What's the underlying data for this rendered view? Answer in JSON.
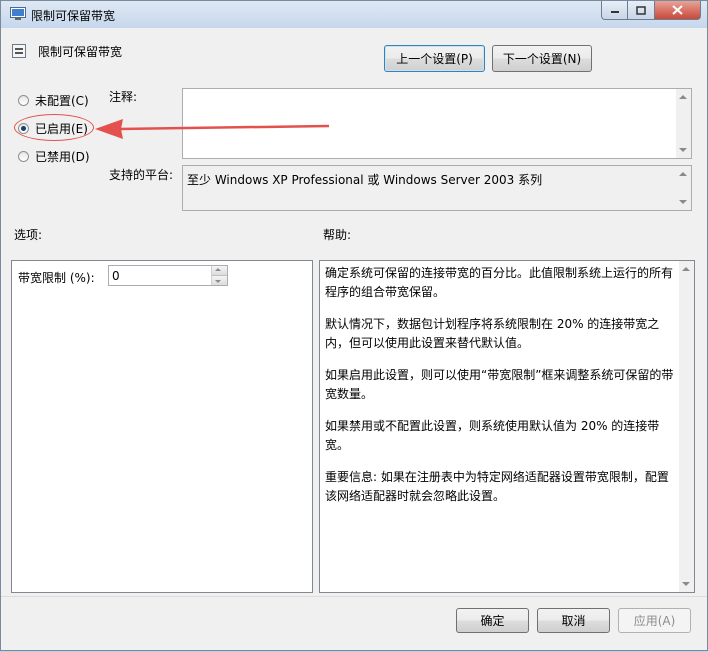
{
  "window": {
    "title": "限制可保留带宽"
  },
  "header": {
    "policy_name": "限制可保留带宽",
    "prev_button": "上一个设置(P)",
    "next_button": "下一个设置(N)"
  },
  "state": {
    "options": [
      {
        "label": "未配置(C)",
        "checked": false
      },
      {
        "label": "已启用(E)",
        "checked": true
      },
      {
        "label": "已禁用(D)",
        "checked": false
      }
    ]
  },
  "comment": {
    "label": "注释:",
    "value": ""
  },
  "platform": {
    "label": "支持的平台:",
    "value": "至少 Windows XP Professional 或 Windows Server 2003 系列"
  },
  "options_section": {
    "title": "选项:",
    "bandwidth_label": "带宽限制 (%):",
    "bandwidth_value": "0"
  },
  "help_section": {
    "title": "帮助:",
    "paragraphs": [
      "确定系统可保留的连接带宽的百分比。此值限制系统上运行的所有程序的组合带宽保留。",
      "默认情况下，数据包计划程序将系统限制在 20% 的连接带宽之内，但可以使用此设置来替代默认值。",
      "如果启用此设置，则可以使用“带宽限制”框来调整系统可保留的带宽数量。",
      "如果禁用或不配置此设置，则系统使用默认值为 20% 的连接带宽。",
      "重要信息: 如果在注册表中为特定网络适配器设置带宽限制，配置该网络适配器时就会忽略此设置。"
    ]
  },
  "footer": {
    "ok": "确定",
    "cancel": "取消",
    "apply": "应用(A)"
  },
  "colors": {
    "annotation": "#e4514d",
    "window_bg": "#f0f0f0",
    "focus_border": "#3c7fb1"
  }
}
